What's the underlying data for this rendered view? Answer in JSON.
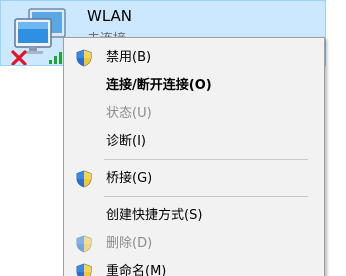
{
  "adapter": {
    "name": "WLAN",
    "status": "未连接"
  },
  "menu": {
    "items": [
      {
        "label": "禁用(B)",
        "shield": true,
        "bold": false,
        "enabled": true
      },
      {
        "label": "连接/断开连接(O)",
        "shield": false,
        "bold": true,
        "enabled": true
      },
      {
        "label": "状态(U)",
        "shield": false,
        "bold": false,
        "enabled": false
      },
      {
        "label": "诊断(I)",
        "shield": false,
        "bold": false,
        "enabled": true
      },
      {
        "label": "桥接(G)",
        "shield": true,
        "bold": false,
        "enabled": true
      },
      {
        "label": "创建快捷方式(S)",
        "shield": false,
        "bold": false,
        "enabled": true
      },
      {
        "label": "删除(D)",
        "shield": true,
        "bold": false,
        "enabled": false
      },
      {
        "label": "重命名(M)",
        "shield": true,
        "bold": false,
        "enabled": true
      }
    ]
  },
  "colors": {
    "selection_bg": "#cce8ff",
    "selection_border": "#99d1ff",
    "menu_bg": "#f2f2f2",
    "disabled_text": "#8c8c8c",
    "error_red": "#e81123",
    "signal_green": "#21a336"
  }
}
